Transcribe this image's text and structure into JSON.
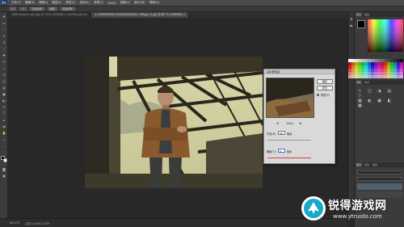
{
  "menubar": {
    "logo": "Ps",
    "items": [
      "文件(F)",
      "编辑(E)",
      "图像(I)",
      "图层(L)",
      "类型(Y)",
      "选择(S)",
      "滤镜(T)",
      "3D(D)",
      "视图(V)",
      "窗口(W)",
      "帮助(H)"
    ]
  },
  "optbar": {
    "items": [
      "⌂",
      "▭",
      "自动选择",
      "图层",
      "变换控件"
    ]
  },
  "tabs": [
    {
      "label": "1866-kewodn.com.jpg @ 100% (RGB/8#) × Kerfile.psd.xml",
      "active": false
    },
    {
      "label": "u=1564946964,2920046284&fm=26&gp=0.jpg @ 66.7% (RGB/8#) ×",
      "active": true
    }
  ],
  "statusbar": {
    "zoom": "66.67%",
    "doc": "文档:1.01M/1.01M"
  },
  "panels": {
    "tabs": [
      "颜色",
      "色板"
    ],
    "tabs2": [
      "调整",
      "样式"
    ],
    "tabs3": [
      "图层",
      "通道",
      "路径"
    ]
  },
  "dialog": {
    "title": "高反差保留",
    "ok": "确定",
    "cancel": "复位",
    "preview_label": "预览(P)",
    "zoom": "100%",
    "radius_label": "半径(R):",
    "radius_value": "28",
    "radius_unit": "像素",
    "threshold_label": "阈值(T):",
    "threshold_value": "0",
    "threshold_unit": "色阶"
  },
  "watermark": {
    "title": "锐得游戏网",
    "url": "www.ytruido.com"
  },
  "colors": {
    "accent": "#1f3c5e",
    "dialog_bg": "#d9d9d9",
    "panel_bg": "#3b3b3b"
  }
}
